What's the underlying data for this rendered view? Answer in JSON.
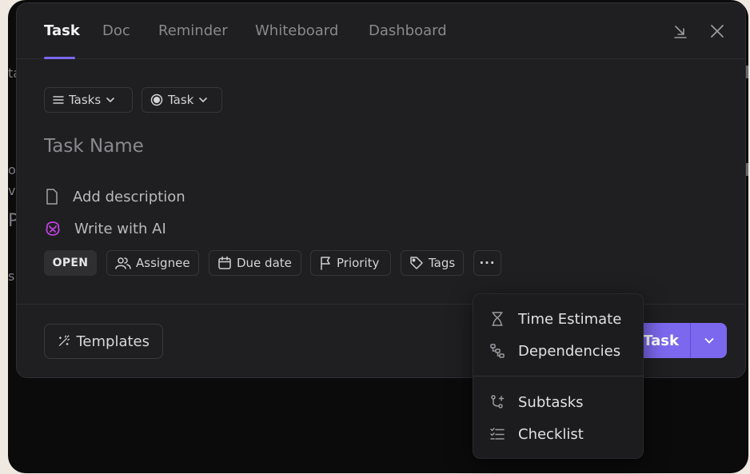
{
  "tabs": [
    {
      "label": "Task",
      "active": true
    },
    {
      "label": "Doc"
    },
    {
      "label": "Reminder"
    },
    {
      "label": "Whiteboard"
    },
    {
      "label": "Dashboard"
    }
  ],
  "selectors": {
    "list": "Tasks",
    "type": "Task"
  },
  "task_name_placeholder": "Task Name",
  "add_description": "Add description",
  "write_with_ai": "Write with AI",
  "attributes": {
    "status": "OPEN",
    "assignee": "Assignee",
    "due_date": "Due date",
    "priority": "Priority",
    "tags": "Tags",
    "more": "···"
  },
  "footer": {
    "templates": "Templates",
    "create_label": "Task"
  },
  "more_menu": {
    "items": [
      {
        "label": "Time Estimate",
        "icon": "hourglass-icon"
      },
      {
        "label": "Dependencies",
        "icon": "dependencies-icon"
      },
      {
        "label": "Subtasks",
        "icon": "subtasks-icon"
      },
      {
        "label": "Checklist",
        "icon": "checklist-icon"
      }
    ]
  },
  "background_fragments": [
    "ta",
    "o",
    "vi",
    "P",
    "s"
  ],
  "colors": {
    "accent": "#7b68ee",
    "modal_bg": "#1f1f21",
    "backdrop": "#0b0b0c",
    "ai_icon": "#c041e0"
  }
}
